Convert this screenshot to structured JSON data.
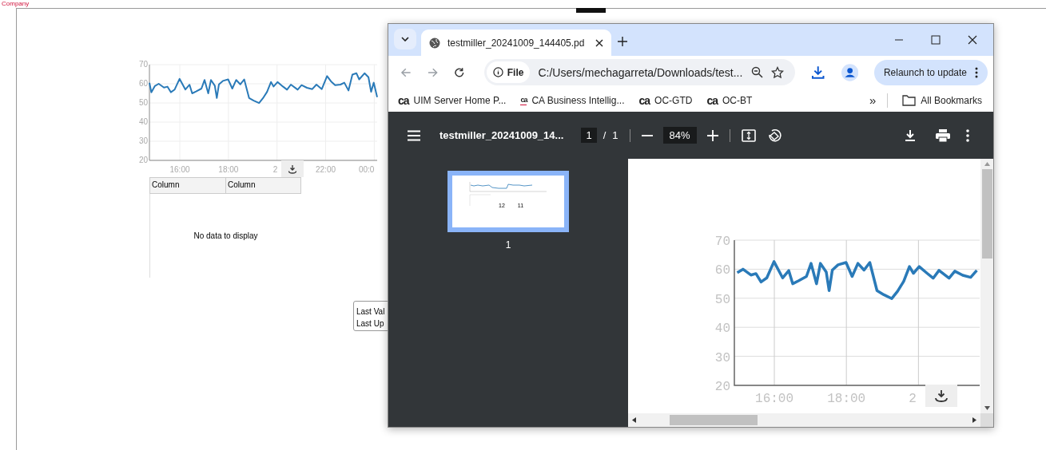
{
  "page": {
    "logo_text": "Company",
    "chart_data": {
      "type": "line",
      "x": [
        14.75,
        14.83,
        14.97,
        15.13,
        15.35,
        15.49,
        15.63,
        15.79,
        15.99,
        16.23,
        16.4,
        16.51,
        16.67,
        16.89,
        17.02,
        17.17,
        17.28,
        17.44,
        17.52,
        17.61,
        17.77,
        17.99,
        18.16,
        18.32,
        18.49,
        18.65,
        18.85,
        19.04,
        19.26,
        19.42,
        19.59,
        19.75,
        19.86,
        20.02,
        20.24,
        20.41,
        20.57,
        20.85,
        21.01,
        21.23,
        21.45,
        21.62,
        21.84,
        22.06,
        22.22,
        22.39,
        22.61,
        22.77,
        22.94,
        23.1,
        23.27,
        23.38,
        23.6,
        23.76,
        23.87,
        23.98,
        24.12
      ],
      "series": [
        {
          "color": "#2a7ab8",
          "values": [
            60.5,
            55.5,
            58.8,
            60,
            58,
            58.5,
            55.6,
            57,
            62.6,
            57,
            59.5,
            55,
            56,
            57.5,
            62,
            55,
            62,
            59,
            52.6,
            59.7,
            61.5,
            62.3,
            57.5,
            62,
            59.7,
            62.3,
            52.6,
            51.2,
            49.9,
            52.4,
            55.8,
            60.9,
            58.6,
            60.9,
            58.6,
            56.9,
            59.6,
            56.9,
            59.3,
            57.9,
            57.2,
            59.6,
            57.2,
            64,
            61.3,
            59.3,
            59.6,
            60.6,
            56.5,
            64.8,
            65.5,
            62.3,
            65.5,
            63.4,
            55.8,
            60.6,
            53
          ]
        }
      ],
      "xlim": [
        14.75,
        24.12
      ],
      "ylim": [
        20,
        70
      ],
      "grid": true,
      "xticks": [
        {
          "value": 16,
          "label": "16:00"
        },
        {
          "value": 18,
          "label": "18:00"
        },
        {
          "value": 22,
          "label": "22:00"
        },
        {
          "value": 24,
          "label": "00:0"
        }
      ],
      "yticks": [
        20,
        30,
        40,
        50,
        60,
        70
      ]
    },
    "chart_cut_label": "2",
    "table": {
      "columns": [
        "Column",
        "Column"
      ],
      "empty_message": "No data to display"
    },
    "info_box": {
      "lines": [
        "Last Val",
        "Last Up"
      ]
    }
  },
  "browser": {
    "tab": {
      "title": "testmiller_20241009_144405.pd",
      "selected": true
    },
    "address": {
      "scheme_chip": "File",
      "url": "C:/Users/mechagarreta/Downloads/test..."
    },
    "relaunch_button": "Relaunch to update",
    "bookmarks": [
      {
        "logo": "ca",
        "kind": "plain",
        "label": "UIM Server Home P..."
      },
      {
        "logo": "ca",
        "kind": "small",
        "label": "CA Business Intellig..."
      },
      {
        "logo": "ca",
        "kind": "plain",
        "label": "OC-GTD"
      },
      {
        "logo": "ca",
        "kind": "plain",
        "label": "OC-BT"
      }
    ],
    "overflow_chevron": "»",
    "all_bookmarks": "All Bookmarks",
    "pdf_toolbar": {
      "title": "testmiller_20241009_14...",
      "page_current": "1",
      "page_separator": "/",
      "page_total": "1",
      "zoom": "84%"
    },
    "thumbnails": [
      {
        "label": "1",
        "selected": true,
        "values": [
          "12",
          "11"
        ]
      }
    ],
    "chart_data": {
      "type": "line",
      "x": [
        14.97,
        15.13,
        15.35,
        15.49,
        15.63,
        15.79,
        15.99,
        16.23,
        16.4,
        16.51,
        16.67,
        16.89,
        17.02,
        17.17,
        17.28,
        17.44,
        17.52,
        17.61,
        17.77,
        17.99,
        18.16,
        18.32,
        18.49,
        18.65,
        18.85,
        19.04,
        19.26,
        19.42,
        19.59,
        19.75,
        19.86,
        20.02,
        20.24,
        20.41,
        20.57,
        20.85,
        21.01,
        21.23,
        21.45,
        21.62
      ],
      "series": [
        {
          "color": "#2a7ab8",
          "values": [
            58.8,
            60,
            58,
            58.5,
            55.6,
            57,
            62.6,
            57,
            59.5,
            55,
            56,
            57.5,
            62,
            55,
            62,
            59,
            52.6,
            59.7,
            61.5,
            62.3,
            57.5,
            62,
            59.7,
            62.3,
            52.6,
            51.2,
            49.9,
            52.4,
            55.8,
            60.9,
            58.6,
            60.9,
            58.6,
            56.9,
            59.6,
            56.9,
            59.3,
            57.9,
            57.2,
            59.6
          ]
        }
      ],
      "xlim": [
        14.89,
        21.7
      ],
      "ylim": [
        20,
        70
      ],
      "grid": true,
      "xticks": [
        {
          "value": 16,
          "label": "16:00"
        },
        {
          "value": 18,
          "label": "18:00"
        }
      ],
      "yticks": [
        20,
        30,
        40,
        50,
        60,
        70
      ]
    },
    "chart_cut_label": "2"
  }
}
